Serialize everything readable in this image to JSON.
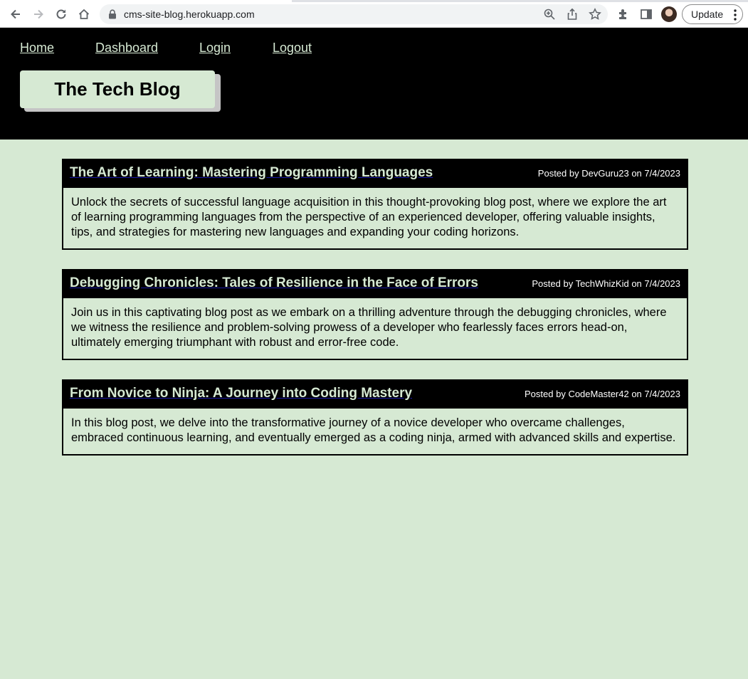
{
  "browser": {
    "url": "cms-site-blog.herokuapp.com",
    "update_label": "Update",
    "icons": [
      "back-icon",
      "forward-icon",
      "reload-icon",
      "home-icon",
      "lock-icon",
      "zoom-icon",
      "share-icon",
      "star-icon",
      "extensions-icon",
      "sidepanel-icon",
      "avatar",
      "menu-dots-icon"
    ]
  },
  "site": {
    "nav": {
      "home": "Home",
      "dashboard": "Dashboard",
      "login": "Login",
      "logout": "Logout"
    },
    "brand": "The Tech Blog"
  },
  "posts": [
    {
      "title": "The Art of Learning: Mastering Programming Languages",
      "meta": "Posted by DevGuru23 on 7/4/2023",
      "body": "Unlock the secrets of successful language acquisition in this thought-provoking blog post, where we explore the art of learning programming languages from the perspective of an experienced developer, offering valuable insights, tips, and strategies for mastering new languages and expanding your coding horizons."
    },
    {
      "title": "Debugging Chronicles: Tales of Resilience in the Face of Errors",
      "meta": "Posted by TechWhizKid on 7/4/2023",
      "body": "Join us in this captivating blog post as we embark on a thrilling adventure through the debugging chronicles, where we witness the resilience and problem-solving prowess of a developer who fearlessly faces errors head-on, ultimately emerging triumphant with robust and error-free code."
    },
    {
      "title": "From Novice to Ninja: A Journey into Coding Mastery",
      "meta": "Posted by CodeMaster42 on 7/4/2023",
      "body": "In this blog post, we delve into the transformative journey of a novice developer who overcame challenges, embraced continuous learning, and eventually emerged as a coding ninja, armed with advanced skills and expertise."
    }
  ],
  "colors": {
    "background": "#d6e9d3",
    "header": "#000000",
    "accent_text": "#d6e9d3"
  }
}
